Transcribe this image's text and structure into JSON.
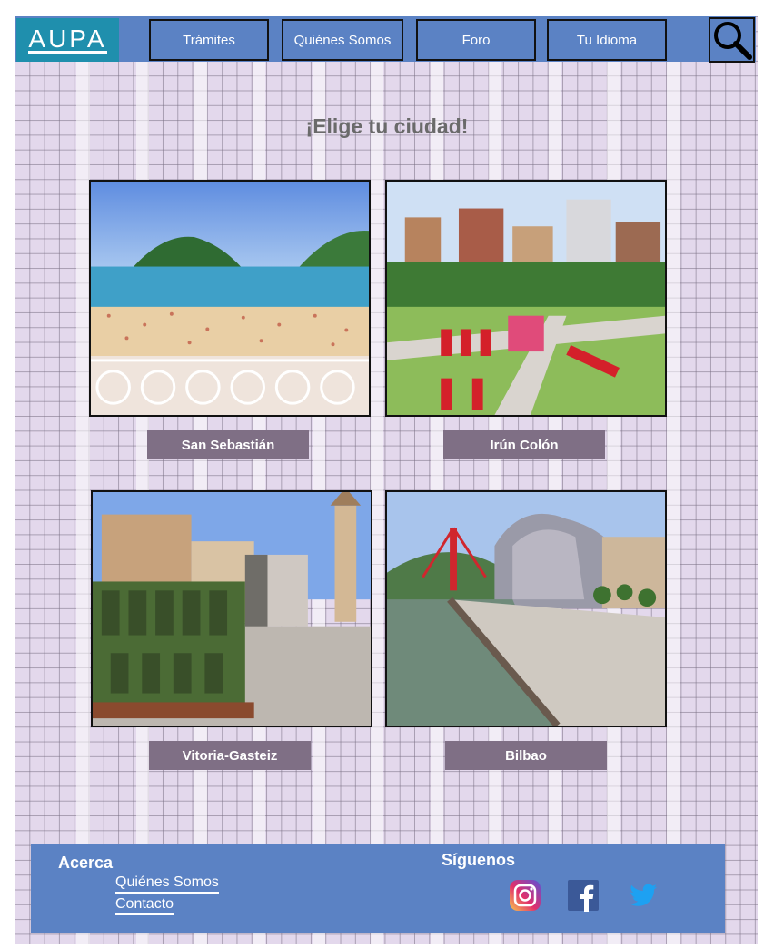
{
  "header": {
    "logo_text": "AUPA",
    "nav": [
      {
        "label": "Trámites"
      },
      {
        "label": "Quiénes Somos"
      },
      {
        "label": "Foro"
      },
      {
        "label": "Tu Idioma"
      }
    ],
    "search_icon": "search-icon"
  },
  "main": {
    "title": "¡Elige tu ciudad!",
    "cities": [
      {
        "label": "San Sebastián",
        "image": "beach-bay-photo"
      },
      {
        "label": "Irún Colón",
        "image": "city-park-photo"
      },
      {
        "label": "Vitoria-Gasteiz",
        "image": "plaza-sculpture-photo"
      },
      {
        "label": "Bilbao",
        "image": "river-museum-photo"
      }
    ]
  },
  "footer": {
    "about_heading": "Acerca",
    "links": [
      {
        "label": "Quiénes Somos"
      },
      {
        "label": "Contacto"
      }
    ],
    "follow_heading": "Síguenos",
    "social": [
      "instagram-icon",
      "facebook-icon",
      "twitter-icon"
    ]
  },
  "colors": {
    "header_blue": "#5b82c4",
    "logo_teal": "#1f8fad",
    "label_purple": "#7f6f85",
    "grid_lilac": "#e3d8ec"
  }
}
